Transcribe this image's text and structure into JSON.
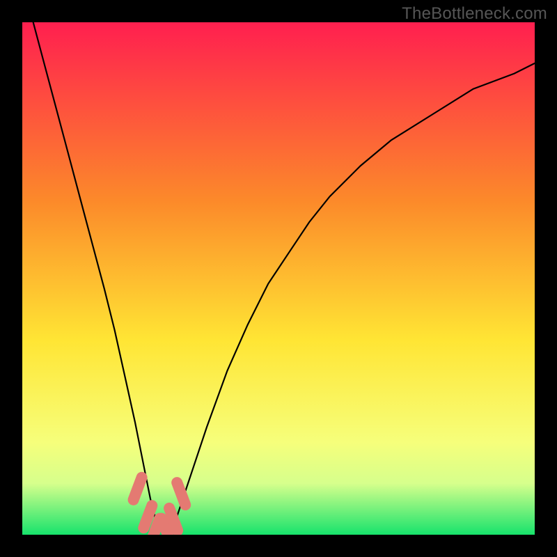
{
  "watermark": "TheBottleneck.com",
  "colors": {
    "frame": "#000000",
    "gradient_top": "#ff1f4f",
    "gradient_mid1": "#fc8a2a",
    "gradient_mid2": "#ffe534",
    "gradient_low": "#f6ff7b",
    "gradient_band": "#d6ff8c",
    "gradient_bottom": "#17e36c",
    "curve": "#000000",
    "marker": "#e47a72"
  },
  "chart_data": {
    "type": "line",
    "title": "",
    "xlabel": "",
    "ylabel": "",
    "xlim": [
      0,
      100
    ],
    "ylim": [
      0,
      100
    ],
    "series": [
      {
        "name": "bottleneck-curve",
        "x": [
          0,
          4,
          8,
          12,
          16,
          18,
          20,
          22,
          24,
          25,
          26,
          27,
          28,
          29,
          30,
          32,
          36,
          40,
          44,
          48,
          52,
          56,
          60,
          66,
          72,
          80,
          88,
          96,
          100
        ],
        "y": [
          108,
          93,
          78,
          63,
          48,
          40,
          31,
          22,
          12,
          7,
          3,
          1,
          0.5,
          1,
          3,
          9,
          21,
          32,
          41,
          49,
          55,
          61,
          66,
          72,
          77,
          82,
          87,
          90,
          92
        ]
      }
    ],
    "markers": [
      {
        "x": 22.5,
        "y": 9
      },
      {
        "x": 24.5,
        "y": 3.5
      },
      {
        "x": 26.0,
        "y": 1
      },
      {
        "x": 28.0,
        "y": 1
      },
      {
        "x": 29.5,
        "y": 3
      },
      {
        "x": 31.0,
        "y": 8
      }
    ],
    "ideal_band": {
      "ymin": 0,
      "ymax": 14
    }
  }
}
